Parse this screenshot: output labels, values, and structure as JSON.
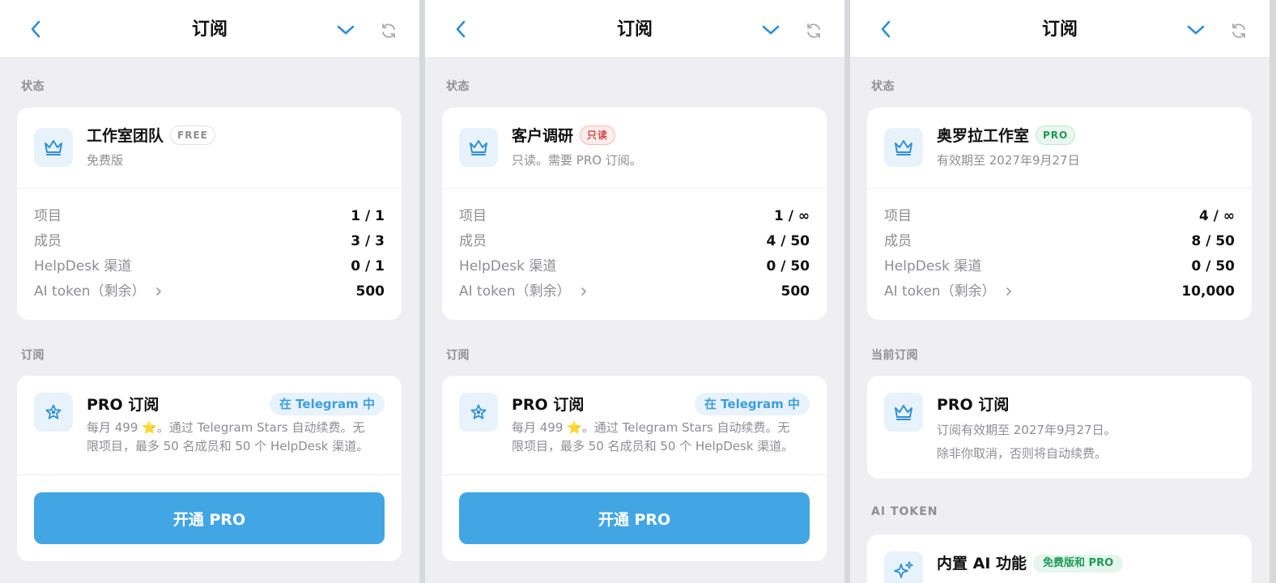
{
  "screens": [
    {
      "header": {
        "title": "订阅"
      },
      "status": {
        "section_label": "状态",
        "workspace_name": "工作室团队",
        "badge": "FREE",
        "subtitle": "免费版",
        "rows": [
          {
            "label": "项目",
            "value": "1 / 1"
          },
          {
            "label": "成员",
            "value": "3 / 3"
          },
          {
            "label": "HelpDesk 渠道",
            "value": "0 / 1"
          },
          {
            "label": "AI token（剩余）",
            "value": "500"
          }
        ]
      },
      "subscription": {
        "section_label": "订阅",
        "plan_name": "PRO 订阅",
        "badge": "在 Telegram 中",
        "desc_line1": "每月 499 ⭐️。通过 Telegram Stars 自动续费。无",
        "desc_line2": "限项目，最多 50 名成员和 50 个 HelpDesk 渠道。",
        "button": "开通 PRO"
      }
    },
    {
      "header": {
        "title": "订阅"
      },
      "status": {
        "section_label": "状态",
        "workspace_name": "客户调研",
        "badge": "只读",
        "subtitle": "只读。需要 PRO 订阅。",
        "rows": [
          {
            "label": "项目",
            "value": "1 / ∞"
          },
          {
            "label": "成员",
            "value": "4 / 50"
          },
          {
            "label": "HelpDesk 渠道",
            "value": "0 / 50"
          },
          {
            "label": "AI token（剩余）",
            "value": "500"
          }
        ]
      },
      "subscription": {
        "section_label": "订阅",
        "plan_name": "PRO 订阅",
        "badge": "在 Telegram 中",
        "desc_line1": "每月 499 ⭐️。通过 Telegram Stars 自动续费。无",
        "desc_line2": "限项目，最多 50 名成员和 50 个 HelpDesk 渠道。",
        "button": "开通 PRO"
      }
    },
    {
      "header": {
        "title": "订阅"
      },
      "status": {
        "section_label": "状态",
        "workspace_name": "奥罗拉工作室",
        "badge": "PRO",
        "subtitle": "有效期至 2027年9月27日",
        "rows": [
          {
            "label": "项目",
            "value": "4 / ∞"
          },
          {
            "label": "成员",
            "value": "8 / 50"
          },
          {
            "label": "HelpDesk 渠道",
            "value": "0 / 50"
          },
          {
            "label": "AI token（剩余）",
            "value": "10,000"
          }
        ]
      },
      "current": {
        "section_label": "当前订阅",
        "plan_name": "PRO 订阅",
        "line1": "订阅有效期至 2027年9月27日。",
        "line2": "除非你取消，否则将自动续费。"
      },
      "ai": {
        "section_label": "AI TOKEN",
        "name": "内置 AI 功能",
        "badge": "免费版和 PRO"
      }
    }
  ],
  "colors": {
    "accent": "#43a6e4",
    "background": "#efeff1",
    "pro_green": "#1f9a58",
    "readonly_red": "#d64545"
  },
  "icons": [
    "back-icon",
    "chevron-down-icon",
    "refresh-icon",
    "crown-icon",
    "star-icon",
    "sparkles-icon",
    "chevron-right-icon"
  ]
}
